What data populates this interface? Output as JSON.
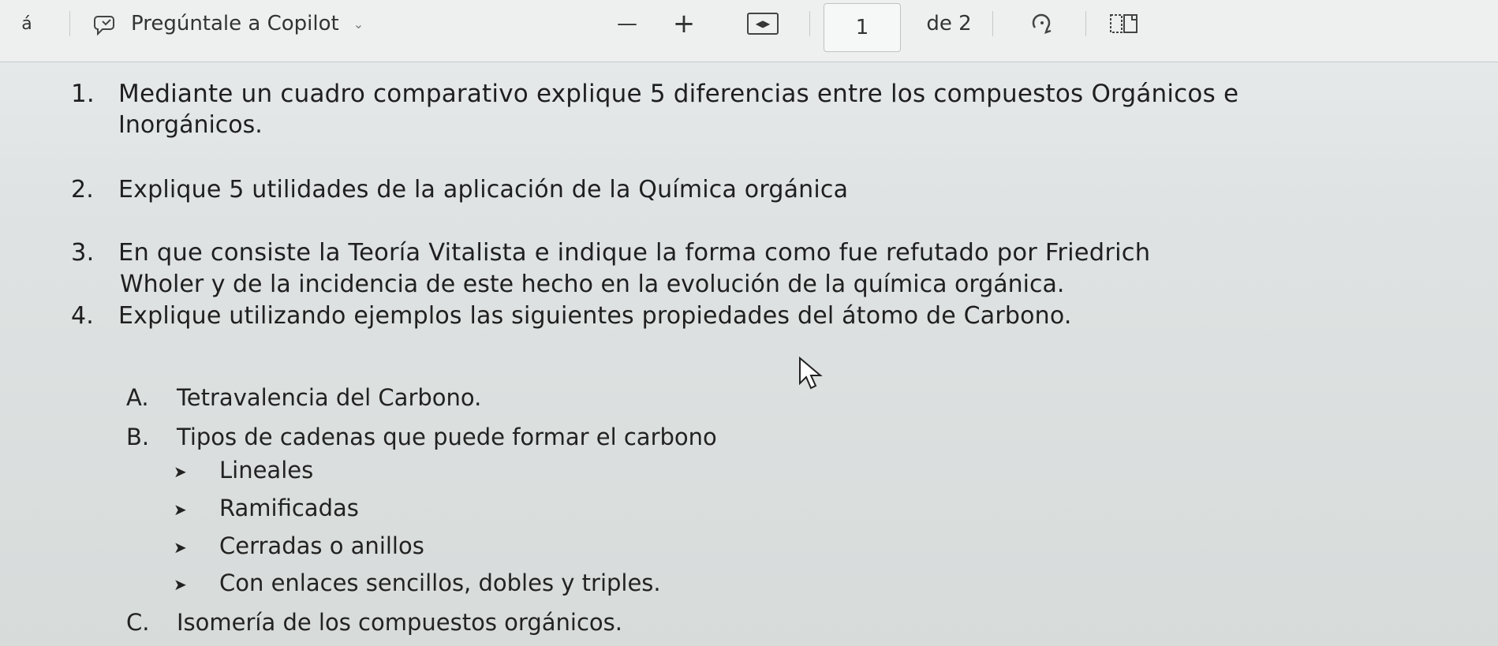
{
  "toolbar": {
    "draw_label": "á",
    "copilot_label": "Pregúntale a Copilot",
    "zoom_out": "—",
    "zoom_in": "+",
    "page_current": "1",
    "page_of": "de 2"
  },
  "document": {
    "questions": [
      {
        "num": "1.",
        "line1": "Mediante un cuadro comparativo explique 5 diferencias entre los compuestos Orgánicos e",
        "line2": "Inorgánicos."
      },
      {
        "num": "2.",
        "line1": "Explique 5 utilidades de la aplicación de la Química orgánica"
      },
      {
        "num": "3.",
        "line1": "En que consiste la Teoría Vitalista e indique la forma como fue refutado por Friedrich",
        "line2": "Wholer y de la incidencia de este hecho en la evolución de la química orgánica."
      },
      {
        "num": "4.",
        "line1": "Explique utilizando ejemplos las siguientes propiedades del átomo de Carbono."
      }
    ],
    "subitems": [
      {
        "letter": "A.",
        "text": "Tetravalencia del Carbono."
      },
      {
        "letter": "B.",
        "text": "Tipos de cadenas que puede formar el carbono"
      },
      {
        "letter": "C.",
        "text": "Isomería de los compuestos orgánicos."
      }
    ],
    "bullets": [
      "Lineales",
      "Ramificadas",
      "Cerradas o anillos",
      "Con enlaces sencillos, dobles y triples."
    ]
  },
  "colors": {
    "toolbar_bg": "#eef0f0",
    "page_bg": "#dfe3e3",
    "text": "#1f1f1f"
  }
}
